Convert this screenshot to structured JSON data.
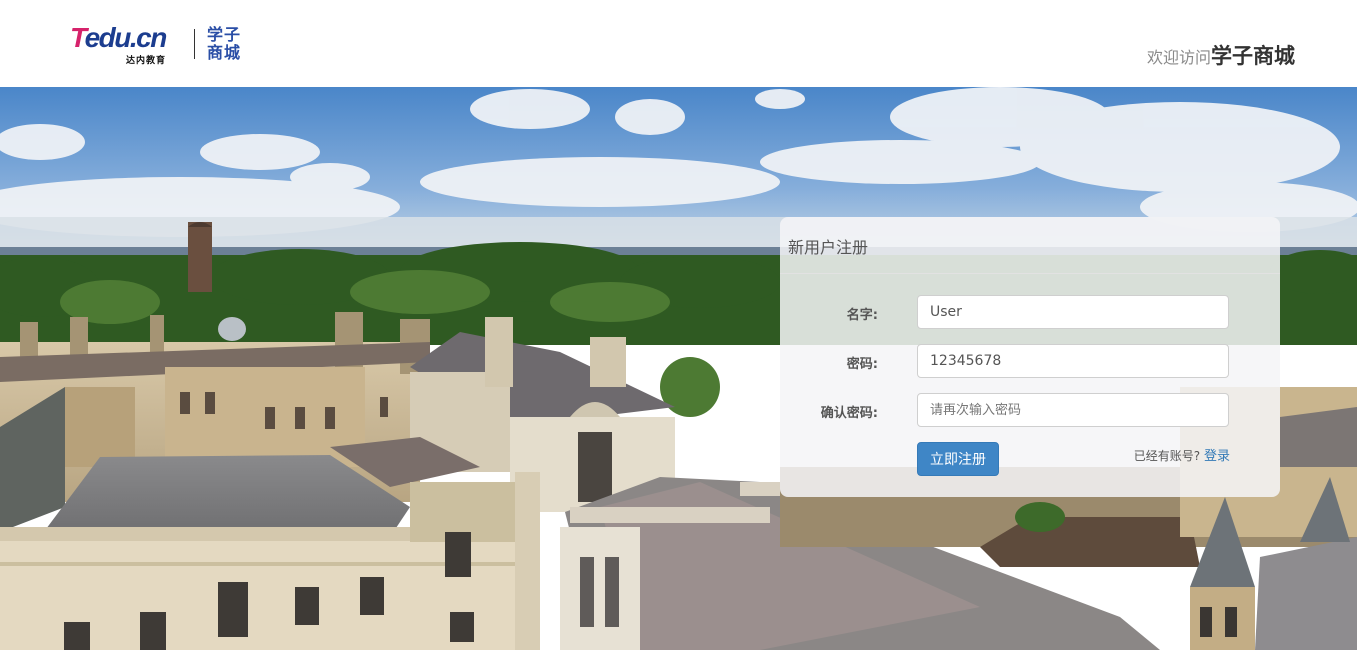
{
  "header": {
    "logo": {
      "brand_prefix": "T",
      "brand_rest": "edu.cn",
      "brand_sub": "达内教育",
      "site_name": "学子商城"
    },
    "welcome_prefix": "欢迎访问",
    "welcome_site": "学子商城"
  },
  "register": {
    "title": "新用户注册",
    "fields": [
      {
        "label": "名字:",
        "value": "User",
        "placeholder": ""
      },
      {
        "label": "密码:",
        "value": "12345678",
        "placeholder": ""
      },
      {
        "label": "确认密码:",
        "value": "",
        "placeholder": "请再次输入密码"
      }
    ],
    "submit_label": "立即注册",
    "login_prompt": "已经有账号?",
    "login_link": "登录"
  },
  "colors": {
    "brand_blue": "#1c3d8f",
    "brand_pink": "#d6226b",
    "primary_button": "#3f86c6",
    "link": "#337ab7"
  }
}
